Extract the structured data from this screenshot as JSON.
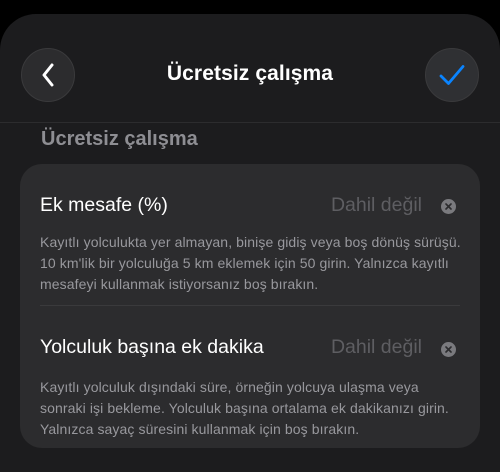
{
  "nav": {
    "title": "Ücretsiz çalışma",
    "back_icon": "chevron-left-icon",
    "done_icon": "checkmark-icon",
    "accent_color": "#0a84ff"
  },
  "section": {
    "header": "Ücretsiz çalışma"
  },
  "fields": [
    {
      "label": "Ek mesafe (%)",
      "value": "Dahil değil",
      "description": "Kayıtlı yolculukta yer almayan, binişe gidiş veya boş dönüş sürüşü. 10 km'lik bir yolculuğa 5 km eklemek için 50 girin. Yalnızca kayıtlı mesafeyi kullanmak istiyorsanız boş bırakın.",
      "clear_icon": "clear-circle-icon"
    },
    {
      "label": "Yolculuk başına ek dakika",
      "value": "Dahil değil",
      "description": "Kayıtlı yolculuk dışındaki süre, örneğin yolcuya ulaşma veya sonraki işi bekleme. Yolculuk başına ortalama ek dakikanızı girin. Yalnızca sayaç süresini kullanmak için boş bırakın.",
      "clear_icon": "clear-circle-icon"
    }
  ]
}
